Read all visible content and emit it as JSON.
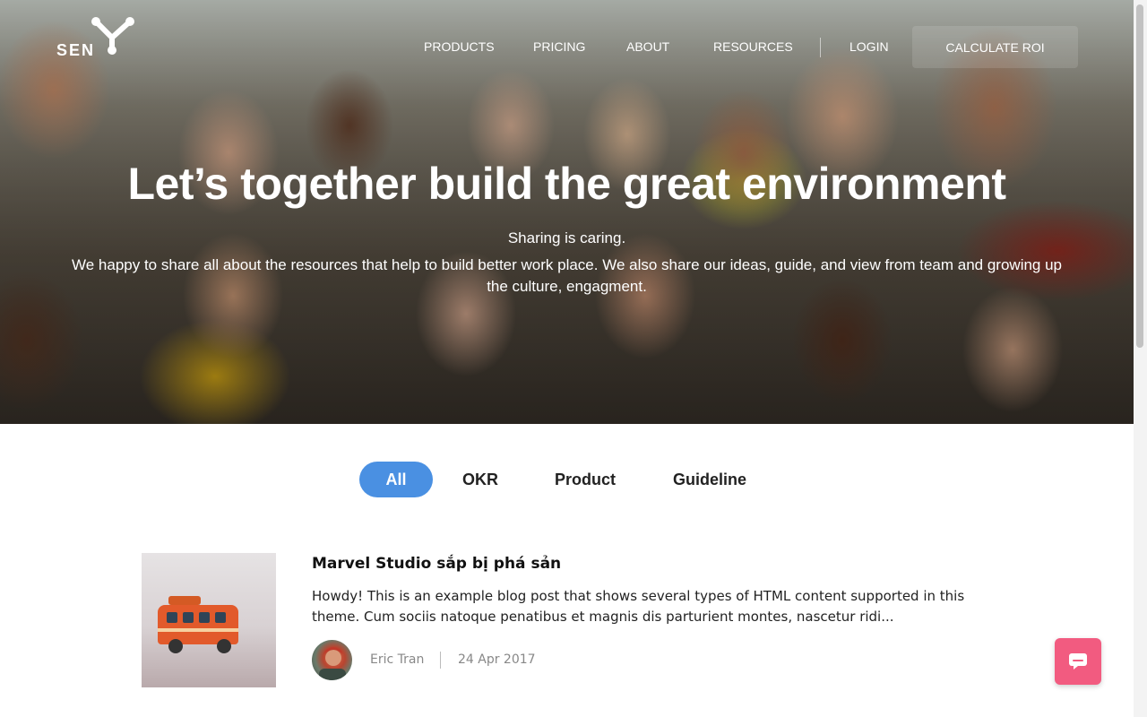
{
  "brand": {
    "name": "SEN"
  },
  "nav": {
    "items": [
      {
        "label": "PRODUCTS"
      },
      {
        "label": "PRICING"
      },
      {
        "label": "ABOUT"
      },
      {
        "label": "RESOURCES"
      },
      {
        "label": "LOGIN"
      }
    ],
    "cta": "CALCULATE ROI"
  },
  "hero": {
    "title": "Let’s together build the great environment",
    "subtitle": "Sharing is caring.",
    "description": "We happy to share all about the resources that help to build better work place. We also share our ideas, guide, and view from team and growing up the culture, engagment."
  },
  "filters": {
    "tabs": [
      {
        "label": "All",
        "active": true
      },
      {
        "label": "OKR",
        "active": false
      },
      {
        "label": "Product",
        "active": false
      },
      {
        "label": "Guideline",
        "active": false
      }
    ]
  },
  "posts": [
    {
      "title": "Marvel Studio sắp bị phá sản",
      "excerpt": "Howdy! This is an example blog post that shows several types of HTML content supported in this theme. Cum sociis natoque penatibus et magnis dis parturient montes, nascetur ridi...",
      "author": "Eric Tran",
      "date": "24 Apr 2017",
      "thumbnail_icon": "toy-bus-image",
      "avatar_icon": "author-avatar"
    }
  ],
  "chat": {
    "icon": "chat-bubble-icon",
    "color": "#f25b80"
  },
  "colors": {
    "accent": "#4a90e2",
    "chat": "#f25b80"
  }
}
